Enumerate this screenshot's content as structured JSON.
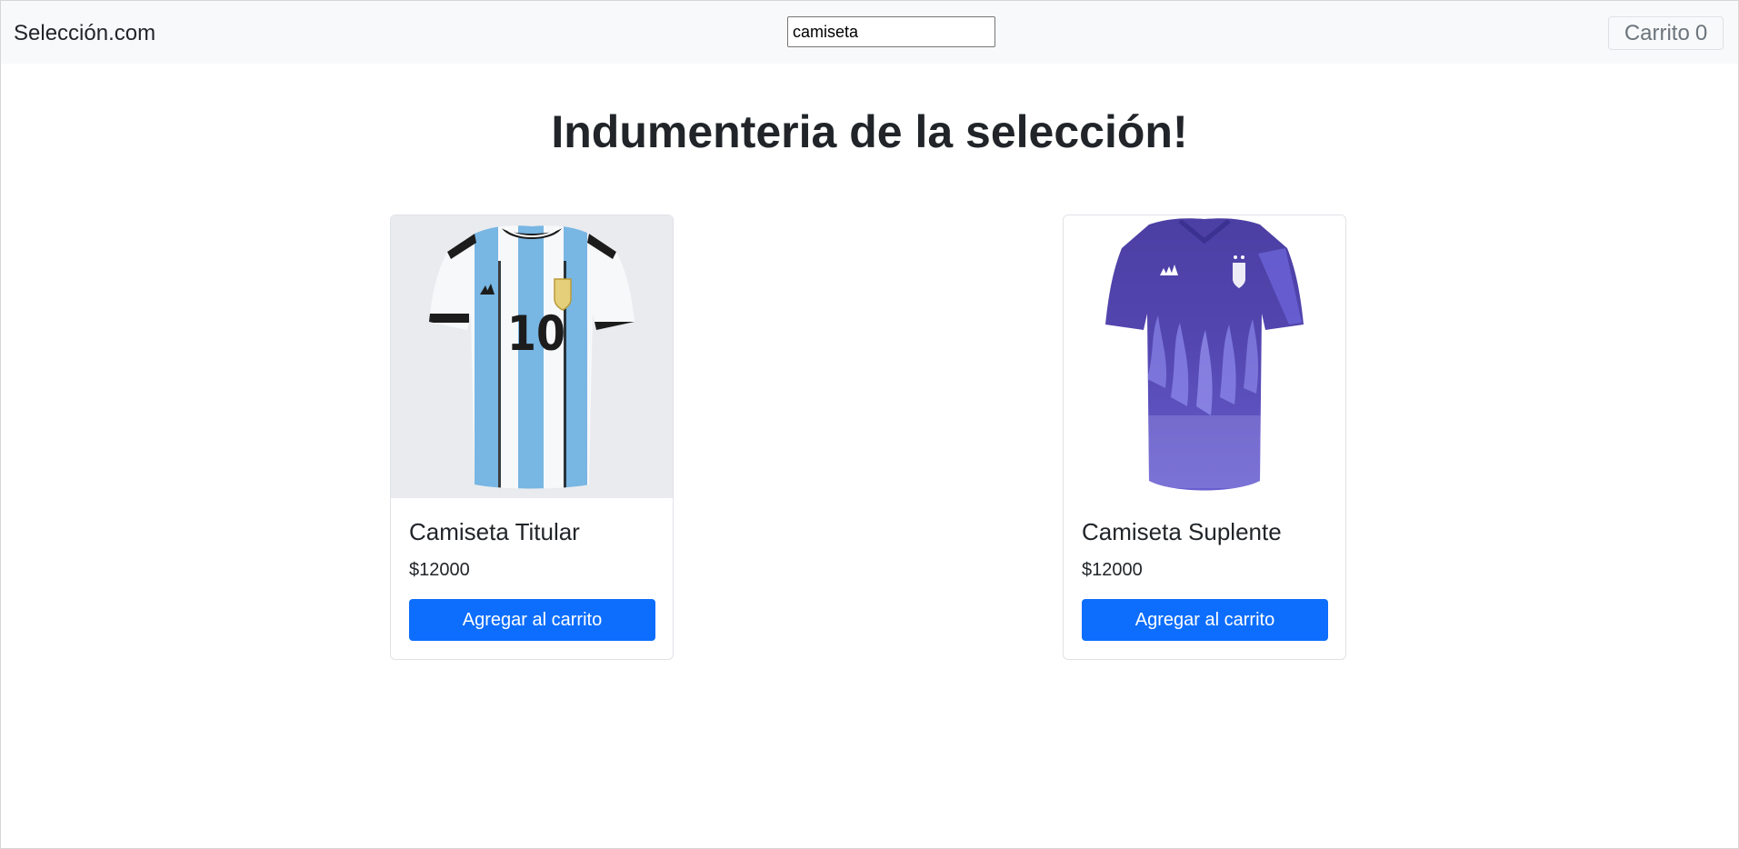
{
  "navbar": {
    "brand": "Selección.com",
    "search_value": "camiseta",
    "cart_label": "Carrito",
    "cart_count": "0"
  },
  "page": {
    "heading": "Indumenteria de la selección!"
  },
  "products": [
    {
      "name": "Camiseta Titular",
      "price": "$12000",
      "button_label": "Agregar al carrito",
      "image_icon": "argentina-home-jersey-image"
    },
    {
      "name": "Camiseta Suplente",
      "price": "$12000",
      "button_label": "Agregar al carrito",
      "image_icon": "argentina-away-jersey-image"
    }
  ],
  "colors": {
    "primary_button": "#0d6efd",
    "navbar_bg": "#f8f9fa",
    "home_stripe_blue": "#75b3e1",
    "away_purple": "#4a3f9e"
  }
}
